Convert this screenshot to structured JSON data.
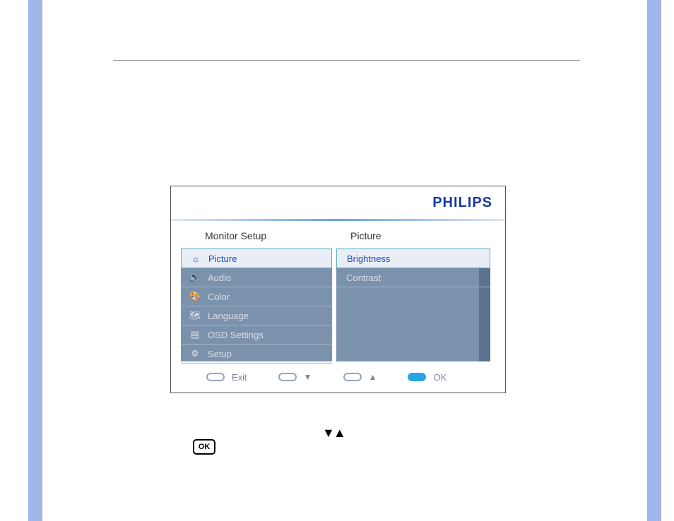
{
  "brand": "PHILIPS",
  "section_titles": {
    "left": "Monitor Setup",
    "right": "Picture"
  },
  "left_menu": [
    {
      "icon": "☼",
      "label": "Picture",
      "selected": true,
      "icon_name": "sun-icon"
    },
    {
      "icon": "🔈",
      "label": "Audio",
      "selected": false,
      "icon_name": "speaker-icon"
    },
    {
      "icon": "🎨",
      "label": "Color",
      "selected": false,
      "icon_name": "palette-icon"
    },
    {
      "icon": "🗺",
      "label": "Language",
      "selected": false,
      "icon_name": "language-icon"
    },
    {
      "icon": "▤",
      "label": "OSD Settings",
      "selected": false,
      "icon_name": "osd-icon"
    },
    {
      "icon": "⚙",
      "label": "Setup",
      "selected": false,
      "icon_name": "gear-icon"
    }
  ],
  "right_menu": [
    {
      "label": "Brightness",
      "selected": true
    },
    {
      "label": "Contrast",
      "selected": false
    }
  ],
  "footer": {
    "exit": "Exit",
    "down": "▼",
    "up": "▲",
    "ok": "OK"
  },
  "below": {
    "arrows": "▼▲",
    "ok_badge": "OK"
  }
}
